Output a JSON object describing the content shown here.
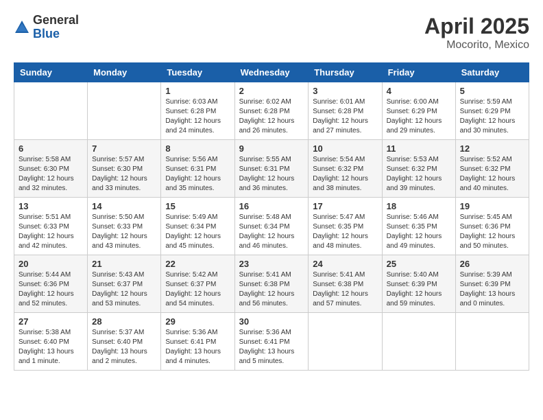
{
  "header": {
    "logo_general": "General",
    "logo_blue": "Blue",
    "month": "April 2025",
    "location": "Mocorito, Mexico"
  },
  "weekdays": [
    "Sunday",
    "Monday",
    "Tuesday",
    "Wednesday",
    "Thursday",
    "Friday",
    "Saturday"
  ],
  "weeks": [
    [
      {
        "day": "",
        "info": ""
      },
      {
        "day": "",
        "info": ""
      },
      {
        "day": "1",
        "info": "Sunrise: 6:03 AM\nSunset: 6:28 PM\nDaylight: 12 hours and 24 minutes."
      },
      {
        "day": "2",
        "info": "Sunrise: 6:02 AM\nSunset: 6:28 PM\nDaylight: 12 hours and 26 minutes."
      },
      {
        "day": "3",
        "info": "Sunrise: 6:01 AM\nSunset: 6:28 PM\nDaylight: 12 hours and 27 minutes."
      },
      {
        "day": "4",
        "info": "Sunrise: 6:00 AM\nSunset: 6:29 PM\nDaylight: 12 hours and 29 minutes."
      },
      {
        "day": "5",
        "info": "Sunrise: 5:59 AM\nSunset: 6:29 PM\nDaylight: 12 hours and 30 minutes."
      }
    ],
    [
      {
        "day": "6",
        "info": "Sunrise: 5:58 AM\nSunset: 6:30 PM\nDaylight: 12 hours and 32 minutes."
      },
      {
        "day": "7",
        "info": "Sunrise: 5:57 AM\nSunset: 6:30 PM\nDaylight: 12 hours and 33 minutes."
      },
      {
        "day": "8",
        "info": "Sunrise: 5:56 AM\nSunset: 6:31 PM\nDaylight: 12 hours and 35 minutes."
      },
      {
        "day": "9",
        "info": "Sunrise: 5:55 AM\nSunset: 6:31 PM\nDaylight: 12 hours and 36 minutes."
      },
      {
        "day": "10",
        "info": "Sunrise: 5:54 AM\nSunset: 6:32 PM\nDaylight: 12 hours and 38 minutes."
      },
      {
        "day": "11",
        "info": "Sunrise: 5:53 AM\nSunset: 6:32 PM\nDaylight: 12 hours and 39 minutes."
      },
      {
        "day": "12",
        "info": "Sunrise: 5:52 AM\nSunset: 6:32 PM\nDaylight: 12 hours and 40 minutes."
      }
    ],
    [
      {
        "day": "13",
        "info": "Sunrise: 5:51 AM\nSunset: 6:33 PM\nDaylight: 12 hours and 42 minutes."
      },
      {
        "day": "14",
        "info": "Sunrise: 5:50 AM\nSunset: 6:33 PM\nDaylight: 12 hours and 43 minutes."
      },
      {
        "day": "15",
        "info": "Sunrise: 5:49 AM\nSunset: 6:34 PM\nDaylight: 12 hours and 45 minutes."
      },
      {
        "day": "16",
        "info": "Sunrise: 5:48 AM\nSunset: 6:34 PM\nDaylight: 12 hours and 46 minutes."
      },
      {
        "day": "17",
        "info": "Sunrise: 5:47 AM\nSunset: 6:35 PM\nDaylight: 12 hours and 48 minutes."
      },
      {
        "day": "18",
        "info": "Sunrise: 5:46 AM\nSunset: 6:35 PM\nDaylight: 12 hours and 49 minutes."
      },
      {
        "day": "19",
        "info": "Sunrise: 5:45 AM\nSunset: 6:36 PM\nDaylight: 12 hours and 50 minutes."
      }
    ],
    [
      {
        "day": "20",
        "info": "Sunrise: 5:44 AM\nSunset: 6:36 PM\nDaylight: 12 hours and 52 minutes."
      },
      {
        "day": "21",
        "info": "Sunrise: 5:43 AM\nSunset: 6:37 PM\nDaylight: 12 hours and 53 minutes."
      },
      {
        "day": "22",
        "info": "Sunrise: 5:42 AM\nSunset: 6:37 PM\nDaylight: 12 hours and 54 minutes."
      },
      {
        "day": "23",
        "info": "Sunrise: 5:41 AM\nSunset: 6:38 PM\nDaylight: 12 hours and 56 minutes."
      },
      {
        "day": "24",
        "info": "Sunrise: 5:41 AM\nSunset: 6:38 PM\nDaylight: 12 hours and 57 minutes."
      },
      {
        "day": "25",
        "info": "Sunrise: 5:40 AM\nSunset: 6:39 PM\nDaylight: 12 hours and 59 minutes."
      },
      {
        "day": "26",
        "info": "Sunrise: 5:39 AM\nSunset: 6:39 PM\nDaylight: 13 hours and 0 minutes."
      }
    ],
    [
      {
        "day": "27",
        "info": "Sunrise: 5:38 AM\nSunset: 6:40 PM\nDaylight: 13 hours and 1 minute."
      },
      {
        "day": "28",
        "info": "Sunrise: 5:37 AM\nSunset: 6:40 PM\nDaylight: 13 hours and 2 minutes."
      },
      {
        "day": "29",
        "info": "Sunrise: 5:36 AM\nSunset: 6:41 PM\nDaylight: 13 hours and 4 minutes."
      },
      {
        "day": "30",
        "info": "Sunrise: 5:36 AM\nSunset: 6:41 PM\nDaylight: 13 hours and 5 minutes."
      },
      {
        "day": "",
        "info": ""
      },
      {
        "day": "",
        "info": ""
      },
      {
        "day": "",
        "info": ""
      }
    ]
  ]
}
